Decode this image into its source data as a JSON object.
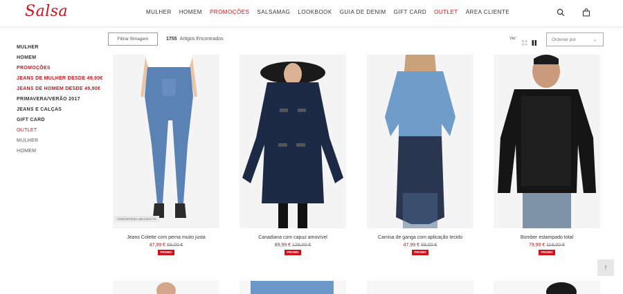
{
  "brand": {
    "logo_text": "Salsa",
    "accent_color": "#d0121b"
  },
  "nav": {
    "items": [
      {
        "label": "MULHER",
        "highlight": false
      },
      {
        "label": "HOMEM",
        "highlight": false
      },
      {
        "label": "PROMOÇÕES",
        "highlight": true
      },
      {
        "label": "SALSAMAG",
        "highlight": false
      },
      {
        "label": "LOOKBOOK",
        "highlight": false
      },
      {
        "label": "GUIA DE DENIM",
        "highlight": false
      },
      {
        "label": "GIFT CARD",
        "highlight": false
      },
      {
        "label": "OUTLET",
        "highlight": true
      },
      {
        "label": "ÁREA CLIENTE",
        "highlight": false
      }
    ],
    "icons": [
      "search-icon",
      "shopping-bag-icon"
    ]
  },
  "toolbar": {
    "filter_label": "Filtrar filmagem",
    "results_count": "1755",
    "results_label": "Artigos Encontrados",
    "view_label": "Ver:",
    "sort_placeholder": "Ordenar por"
  },
  "sidebar": {
    "items": [
      {
        "label": "MULHER",
        "style": "bold"
      },
      {
        "label": "HOMEM",
        "style": "bold"
      },
      {
        "label": "PROMOÇÕES",
        "style": "red"
      },
      {
        "label": "JEANS DE MULHER DESDE 49,90€",
        "style": "red"
      },
      {
        "label": "JEANS DE HOMEM DESDE 49,90€",
        "style": "red"
      },
      {
        "label": "PRIMAVERA/VERÃO 2017",
        "style": "bold"
      },
      {
        "label": "JEANS E CALÇAS",
        "style": "bold"
      },
      {
        "label": "GIFT CARD",
        "style": "bold"
      },
      {
        "label": "OUTLET",
        "style": "red-plain"
      },
      {
        "label": "MULHER",
        "style": "plain"
      },
      {
        "label": "HOMEM",
        "style": "plain"
      }
    ]
  },
  "products": [
    {
      "name": "Jeans Colette com perna muito justa",
      "price_now": "47,99 €",
      "price_old": "69,00 €",
      "badge": "PROMO",
      "tag": "CONFORTÁVEL UM COLETTE"
    },
    {
      "name": "Canadiana com capuz amovível",
      "price_now": "89,99 €",
      "price_old": "129,00 €",
      "badge": "PROMO",
      "tag": ""
    },
    {
      "name": "Camisa de ganga com aplicação tecido",
      "price_now": "47,99 €",
      "price_old": "69,00 €",
      "badge": "PROMO",
      "tag": ""
    },
    {
      "name": "Bomber estampado total",
      "price_now": "79,99 €",
      "price_old": "119,00 €",
      "badge": "PROMO",
      "tag": ""
    }
  ],
  "scroll_top_icon": "arrow-up-icon"
}
